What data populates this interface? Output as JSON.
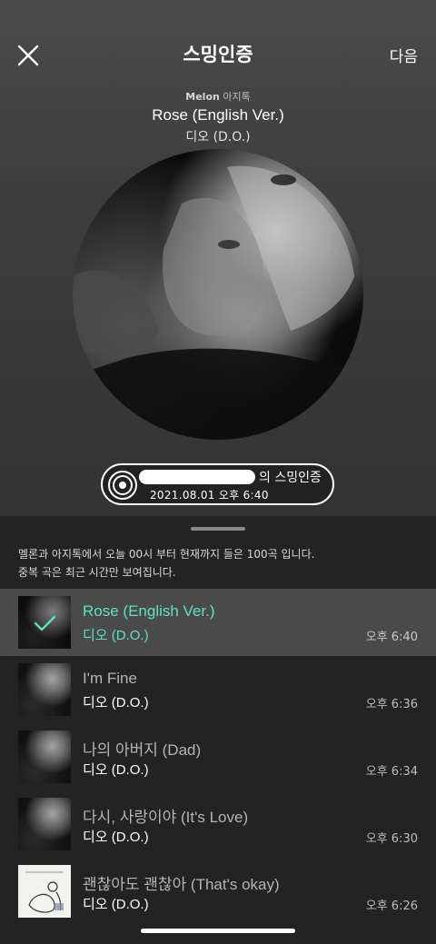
{
  "header": {
    "title": "스밍인증",
    "next_label": "다음"
  },
  "now_playing": {
    "brand_prefix": "Mel",
    "brand_mid": "o",
    "brand_suffix": "n",
    "brand_partner": "아지톡",
    "title": "Rose (English Ver.)",
    "artist": "디오 (D.O.)"
  },
  "badge": {
    "suffix": "의 스밍인증",
    "datetime": "2021.08.01 오후 6:40"
  },
  "notice": {
    "line1": "멜론과 아지톡에서 오늘 00시 부터 현재까지 들은 100곡 입니다.",
    "line2": "중복 곡은 최근 시간만 보여집니다."
  },
  "tracks": [
    {
      "title": "Rose (English Ver.)",
      "artist": "디오 (D.O.)",
      "time": "오후 6:40",
      "selected": true
    },
    {
      "title": "I'm Fine",
      "artist": "디오 (D.O.)",
      "time": "오후 6:36"
    },
    {
      "title": "나의 아버지 (Dad)",
      "artist": "디오 (D.O.)",
      "time": "오후 6:34"
    },
    {
      "title": "다시, 사랑이야 (It's Love)",
      "artist": "디오 (D.O.)",
      "time": "오후 6:30"
    },
    {
      "title": "괜찮아도 괜찮아 (That's okay)",
      "artist": "디오 (D.O.)",
      "time": "오후 6:26"
    }
  ],
  "colors": {
    "accent": "#5fe0c5",
    "selected_row": "#4a4a4a"
  }
}
